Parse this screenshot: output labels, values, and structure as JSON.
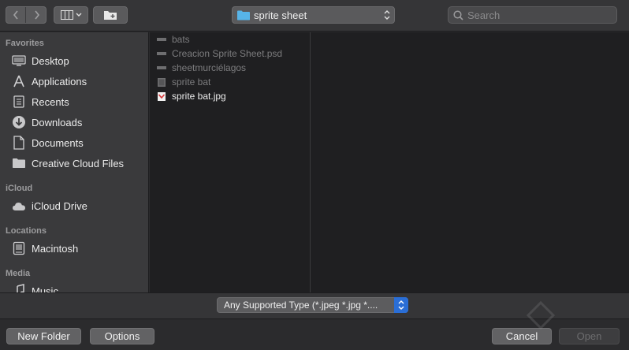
{
  "toolbar": {
    "path": {
      "label": "sprite sheet",
      "icon": "folder-icon",
      "accent": "#57b4e8"
    },
    "search": {
      "placeholder": "Search",
      "value": ""
    }
  },
  "sidebar": {
    "sections": [
      {
        "title": "Favorites",
        "items": [
          {
            "label": "Desktop",
            "icon": "desktop-icon"
          },
          {
            "label": "Applications",
            "icon": "applications-icon"
          },
          {
            "label": "Recents",
            "icon": "recents-icon"
          },
          {
            "label": "Downloads",
            "icon": "downloads-icon"
          },
          {
            "label": "Documents",
            "icon": "documents-icon"
          },
          {
            "label": "Creative Cloud Files",
            "icon": "folder-icon"
          }
        ]
      },
      {
        "title": "iCloud",
        "items": [
          {
            "label": "iCloud Drive",
            "icon": "cloud-icon"
          }
        ]
      },
      {
        "title": "Locations",
        "items": [
          {
            "label": "Macintosh",
            "icon": "hard-drive-icon"
          }
        ]
      },
      {
        "title": "Media",
        "items": [
          {
            "label": "Music",
            "icon": "music-icon"
          }
        ]
      }
    ]
  },
  "files": [
    {
      "name": "bats",
      "icon": "folder-icon",
      "enabled": false
    },
    {
      "name": "Creacion Sprite Sheet.psd",
      "icon": "file-icon",
      "enabled": false
    },
    {
      "name": "sheetmurciélagos",
      "icon": "folder-icon",
      "enabled": false
    },
    {
      "name": "sprite bat",
      "icon": "file-icon",
      "enabled": false
    },
    {
      "name": "sprite bat.jpg",
      "icon": "image-file-icon",
      "enabled": true
    }
  ],
  "file_type": {
    "selected": "Any Supported Type (*.jpeg *.jpg *...."
  },
  "buttons": {
    "new_folder": "New Folder",
    "options": "Options",
    "cancel": "Cancel",
    "open": "Open"
  }
}
